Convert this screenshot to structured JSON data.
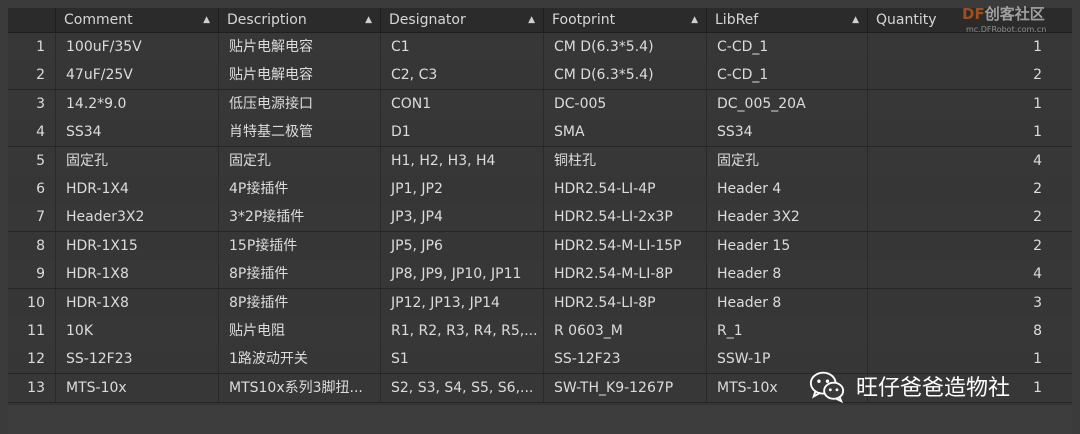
{
  "columns": [
    {
      "key": "num",
      "label": ""
    },
    {
      "key": "comment",
      "label": "Comment",
      "sort": "▲"
    },
    {
      "key": "description",
      "label": "Description",
      "sort": "▲"
    },
    {
      "key": "designator",
      "label": "Designator",
      "sort": "▲"
    },
    {
      "key": "footprint",
      "label": "Footprint",
      "sort": "▲"
    },
    {
      "key": "libref",
      "label": "LibRef",
      "sort": "▲"
    },
    {
      "key": "quantity",
      "label": "Quantity",
      "sort": ""
    }
  ],
  "rows": [
    {
      "num": "1",
      "comment": "100uF/35V",
      "description": "贴片电解电容",
      "designator": "C1",
      "footprint": "CM D(6.3*5.4)",
      "libref": "C-CD_1",
      "quantity": "1"
    },
    {
      "num": "2",
      "comment": "47uF/25V",
      "description": "贴片电解电容",
      "designator": "C2, C3",
      "footprint": "CM D(6.3*5.4)",
      "libref": "C-CD_1",
      "quantity": "2"
    },
    {
      "num": "3",
      "comment": "14.2*9.0",
      "description": "低压电源接口",
      "designator": "CON1",
      "footprint": "DC-005",
      "libref": "DC_005_20A",
      "quantity": "1"
    },
    {
      "num": "4",
      "comment": "SS34",
      "description": "肖特基二极管",
      "designator": "D1",
      "footprint": "SMA",
      "libref": "SS34",
      "quantity": "1"
    },
    {
      "num": "5",
      "comment": "固定孔",
      "description": "固定孔",
      "designator": "H1, H2, H3, H4",
      "footprint": "铜柱孔",
      "libref": "固定孔",
      "quantity": "4"
    },
    {
      "num": "6",
      "comment": "HDR-1X4",
      "description": "4P接插件",
      "designator": "JP1, JP2",
      "footprint": "HDR2.54-LI-4P",
      "libref": "Header 4",
      "quantity": "2"
    },
    {
      "num": "7",
      "comment": "Header3X2",
      "description": "3*2P接插件",
      "designator": "JP3, JP4",
      "footprint": "HDR2.54-LI-2x3P",
      "libref": "Header 3X2",
      "quantity": "2"
    },
    {
      "num": "8",
      "comment": "HDR-1X15",
      "description": "15P接插件",
      "designator": "JP5, JP6",
      "footprint": "HDR2.54-M-LI-15P",
      "libref": "Header 15",
      "quantity": "2"
    },
    {
      "num": "9",
      "comment": "HDR-1X8",
      "description": "8P接插件",
      "designator": "JP8, JP9, JP10, JP11",
      "footprint": "HDR2.54-M-LI-8P",
      "libref": "Header 8",
      "quantity": "4"
    },
    {
      "num": "10",
      "comment": "HDR-1X8",
      "description": "8P接插件",
      "designator": "JP12, JP13, JP14",
      "footprint": "HDR2.54-LI-8P",
      "libref": "Header 8",
      "quantity": "3"
    },
    {
      "num": "11",
      "comment": "10K",
      "description": "贴片电阻",
      "designator": "R1, R2, R3, R4, R5,...",
      "footprint": "R 0603_M",
      "libref": "R_1",
      "quantity": "8"
    },
    {
      "num": "12",
      "comment": "SS-12F23",
      "description": "1路波动开关",
      "designator": "S1",
      "footprint": "SS-12F23",
      "libref": "SSW-1P",
      "quantity": "1"
    },
    {
      "num": "13",
      "comment": "MTS-10x",
      "description": "MTS10x系列3脚扭...",
      "designator": "S2, S3, S4, S5, S6,...",
      "footprint": "SW-TH_K9-1267P",
      "libref": "MTS-10x",
      "quantity": "1"
    }
  ],
  "logo": {
    "brand": "DF",
    "name": "创客社区",
    "site": "mc.DFRobot.com.cn"
  },
  "watermark": {
    "text": "旺仔爸爸造物社",
    "icon": "wechat-icon"
  },
  "colors": {
    "background": "#3b3b3b",
    "header": "#2b2b2b",
    "text": "#dcdcdc",
    "brand": "#ff6a1a"
  }
}
